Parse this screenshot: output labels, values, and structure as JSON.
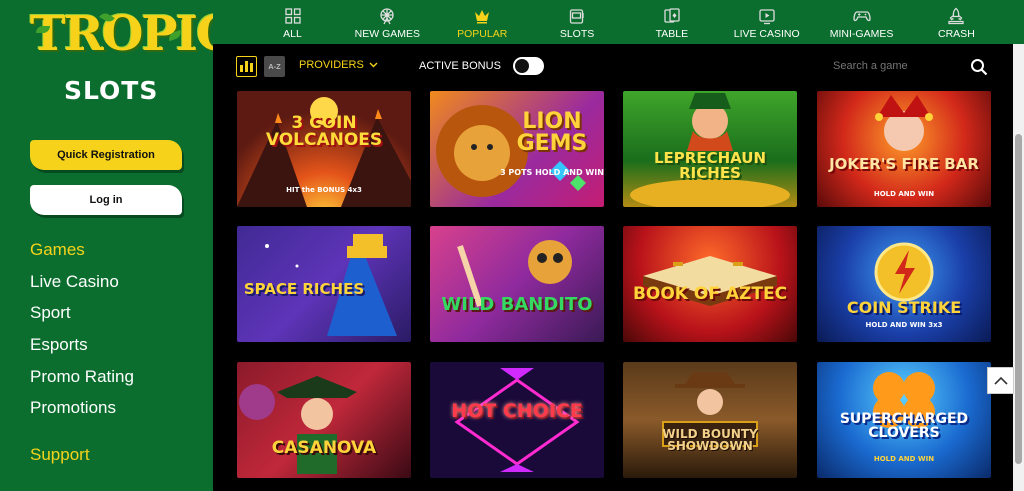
{
  "brand": {
    "logo_line1": "TROPIC",
    "logo_line2": "SLOTS"
  },
  "sidebar": {
    "register_label": "Quick Registration",
    "login_label": "Log in",
    "nav": [
      "Games",
      "Live Casino",
      "Sport",
      "Esports",
      "Promo Rating",
      "Promotions"
    ],
    "active_nav": "Games",
    "support_label": "Support"
  },
  "topnav": {
    "items": [
      {
        "label": "ALL",
        "icon": "grid-icon"
      },
      {
        "label": "NEW GAMES",
        "icon": "ferris-wheel-icon"
      },
      {
        "label": "POPULAR",
        "icon": "crown-icon"
      },
      {
        "label": "SLOTS",
        "icon": "slot-machine-icon"
      },
      {
        "label": "TABLE",
        "icon": "cards-icon"
      },
      {
        "label": "LIVE CASINO",
        "icon": "live-play-icon"
      },
      {
        "label": "MINI-GAMES",
        "icon": "gamepad-icon"
      },
      {
        "label": "CRASH",
        "icon": "rocket-icon"
      }
    ],
    "active": "POPULAR"
  },
  "filters": {
    "sort_az_label": "A-Z",
    "providers_label": "PROVIDERS",
    "active_bonus_label": "ACTIVE BONUS",
    "active_bonus_on": false,
    "search_placeholder": "Search a game"
  },
  "games": [
    {
      "title": "3 COIN VOLCANOES",
      "subtitle": "HIT the BONUS 4x3"
    },
    {
      "title": "LION GEMS",
      "subtitle": "3 POTS HOLD AND WIN"
    },
    {
      "title": "LEPRECHAUN RICHES",
      "subtitle": ""
    },
    {
      "title": "JOKER'S FIRE BAR",
      "subtitle": "HOLD AND WIN"
    },
    {
      "title": "SPACE RICHES",
      "subtitle": ""
    },
    {
      "title": "WILD BANDITO",
      "subtitle": ""
    },
    {
      "title": "BOOK OF AZTEC",
      "subtitle": ""
    },
    {
      "title": "COIN STRIKE",
      "subtitle": "HOLD AND WIN 3x3"
    },
    {
      "title": "CASANOVA",
      "subtitle": ""
    },
    {
      "title": "HOT CHOICE",
      "subtitle": ""
    },
    {
      "title": "WILD BOUNTY SHOWDOWN",
      "subtitle": ""
    },
    {
      "title": "SUPERCHARGED CLOVERS",
      "subtitle": "HOLD AND WIN"
    }
  ],
  "colors": {
    "sidebar_green": "#0b6e2e",
    "accent_yellow": "#f6d31a",
    "background": "#000000"
  }
}
